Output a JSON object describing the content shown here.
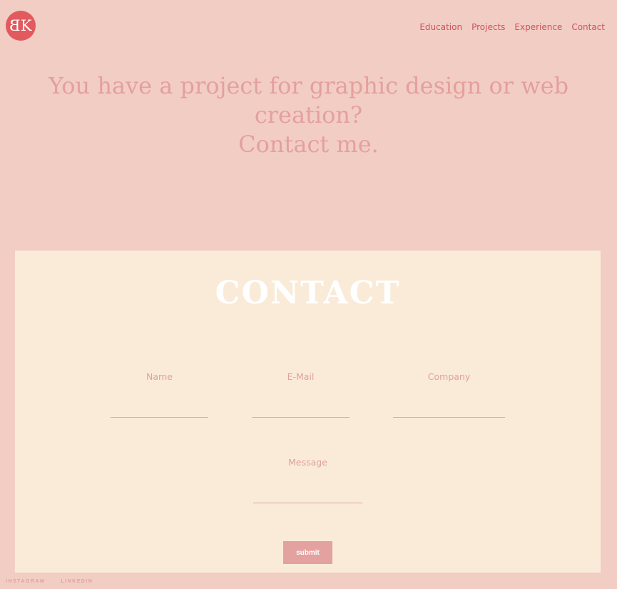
{
  "logo": {
    "letter_left": "B",
    "letter_right": "K"
  },
  "nav": {
    "items": [
      {
        "label": "Education"
      },
      {
        "label": "Projects"
      },
      {
        "label": "Experience"
      },
      {
        "label": "Contact"
      }
    ]
  },
  "hero": {
    "line1": "You have a project for graphic design or web",
    "line2": "creation?",
    "line3": "Contact me."
  },
  "contact": {
    "title": "CONTACT",
    "fields": {
      "name": {
        "label": "Name",
        "value": ""
      },
      "email": {
        "label": "E-Mail",
        "value": ""
      },
      "company": {
        "label": "Company",
        "value": ""
      },
      "message": {
        "label": "Message",
        "value": ""
      }
    },
    "submit_label": "submit"
  },
  "footer": {
    "instagram": "INSTAGRAM",
    "linkedin": "LINKEDIN"
  },
  "colors": {
    "background": "#f2cdc4",
    "accent": "#e05a5e",
    "card": "#faebd8",
    "muted": "#e3a19f"
  }
}
